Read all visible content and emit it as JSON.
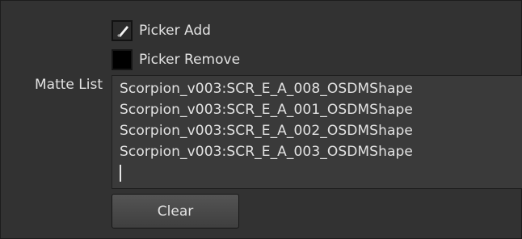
{
  "picker_add": {
    "label": "Picker Add",
    "icon": "eyedropper-icon",
    "checked": true
  },
  "picker_remove": {
    "label": "Picker Remove",
    "icon": "black-swatch",
    "checked": false
  },
  "matte_list": {
    "label": "Matte List",
    "items": [
      "Scorpion_v003:SCR_E_A_008_OSDMShape",
      "Scorpion_v003:SCR_E_A_001_OSDMShape",
      "Scorpion_v003:SCR_E_A_002_OSDMShape",
      "Scorpion_v003:SCR_E_A_003_OSDMShape"
    ]
  },
  "clear_button": {
    "label": "Clear"
  },
  "colors": {
    "panel_background": "#323232",
    "list_background": "#3a3a3a",
    "text": "#e2e2e2"
  }
}
